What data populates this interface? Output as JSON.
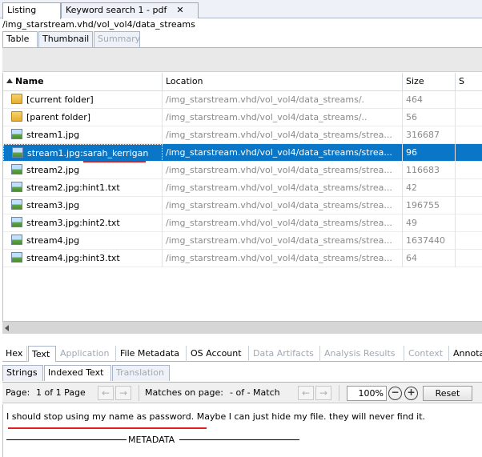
{
  "top_tabs": [
    {
      "label": "Listing"
    },
    {
      "label": "Keyword search 1 - pdf",
      "close": "✕"
    }
  ],
  "path": "/img_starstream.vhd/vol_vol4/data_streams",
  "view_tabs": [
    "Table",
    "Thumbnail",
    "Summary"
  ],
  "table": {
    "columns": [
      "Name",
      "Location",
      "Size",
      "S"
    ],
    "rows": [
      {
        "name": "[current folder]",
        "location": "/img_starstream.vhd/vol_vol4/data_streams/.",
        "size": "464",
        "icon": "folder-icon"
      },
      {
        "name": "[parent folder]",
        "location": "/img_starstream.vhd/vol_vol4/data_streams/..",
        "size": "56",
        "icon": "folder-icon"
      },
      {
        "name": "stream1.jpg",
        "location": "/img_starstream.vhd/vol_vol4/data_streams/strea...",
        "size": "316687",
        "icon": "image-icon"
      },
      {
        "name": "stream1.jpg:sarah_kerrigan",
        "location": "/img_starstream.vhd/vol_vol4/data_streams/strea...",
        "size": "96",
        "icon": "image-icon",
        "selected": true
      },
      {
        "name": "stream2.jpg",
        "location": "/img_starstream.vhd/vol_vol4/data_streams/strea...",
        "size": "116683",
        "icon": "image-icon"
      },
      {
        "name": "stream2.jpg:hint1.txt",
        "location": "/img_starstream.vhd/vol_vol4/data_streams/strea...",
        "size": "42",
        "icon": "image-icon"
      },
      {
        "name": "stream3.jpg",
        "location": "/img_starstream.vhd/vol_vol4/data_streams/strea...",
        "size": "196755",
        "icon": "image-icon"
      },
      {
        "name": "stream3.jpg:hint2.txt",
        "location": "/img_starstream.vhd/vol_vol4/data_streams/strea...",
        "size": "49",
        "icon": "image-icon"
      },
      {
        "name": "stream4.jpg",
        "location": "/img_starstream.vhd/vol_vol4/data_streams/strea...",
        "size": "1637440",
        "icon": "image-icon"
      },
      {
        "name": "stream4.jpg:hint3.txt",
        "location": "/img_starstream.vhd/vol_vol4/data_streams/strea...",
        "size": "64",
        "icon": "image-icon"
      }
    ]
  },
  "content_tabs": [
    "Hex",
    "Text",
    "Application",
    "File Metadata",
    "OS Account",
    "Data Artifacts",
    "Analysis Results",
    "Context",
    "Annota"
  ],
  "text_subtabs": [
    "Strings",
    "Indexed Text",
    "Translation"
  ],
  "pager": {
    "page_label": "Page:",
    "page_value": "1 of 1 Page",
    "matches_label": "Matches on page:",
    "matches_value": "- of - Match",
    "zoom": "100%",
    "reset": "Reset"
  },
  "text_content": "I should stop using my name as password. Maybe I can just hide my file. they will never find it.",
  "metadata_label": "METADATA",
  "colors": {
    "selection": "#0a76c8",
    "annotation": "#e02020"
  }
}
